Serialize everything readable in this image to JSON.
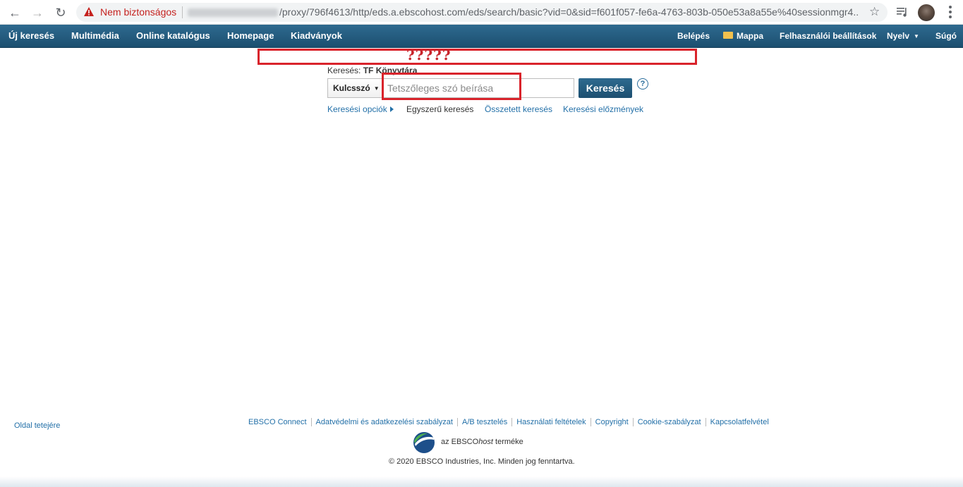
{
  "browser": {
    "insecure_label": "Nem biztonságos",
    "url": "/proxy/796f4613/http/eds.a.ebscohost.com/eds/search/basic?vid=0&sid=f601f057-fe6a-4763-803b-050e53a8a55e%40sessionmgr4..."
  },
  "topnav": {
    "left": [
      "Új keresés",
      "Multimédia",
      "Online katalógus",
      "Homepage",
      "Kiadványok"
    ],
    "login": "Belépés",
    "folder": "Mappa",
    "settings": "Felhasználói beállítások",
    "language": "Nyelv",
    "help": "Súgó"
  },
  "annotation": {
    "question_marks": "?????"
  },
  "search": {
    "label_prefix": "Keresés:",
    "label_target": "TF Könyvtára",
    "field_select": "Kulcsszó",
    "placeholder": "Tetszőleges szó beírása",
    "button": "Keresés",
    "help": "?",
    "options": "Keresési opciók",
    "basic": "Egyszerű keresés",
    "advanced": "Összetett keresés",
    "history": "Keresési előzmények"
  },
  "footer": {
    "back_to_top": "Oldal tetejére",
    "links": [
      "EBSCO Connect",
      "Adatvédelmi és adatkezelési szabályzat",
      "A/B tesztelés",
      "Használati feltételek",
      "Copyright",
      "Cookie-szabályzat",
      "Kapcsolatfelvétel"
    ],
    "product_prefix": "az EBSCO",
    "product_host": "host",
    "product_suffix": "terméke",
    "copyright": "© 2020 EBSCO Industries, Inc. Minden jog fenntartva."
  },
  "colors": {
    "nav_bg": "#1c4f70",
    "link": "#2370a8",
    "annotation": "#d9232b",
    "insecure": "#c5221f"
  }
}
